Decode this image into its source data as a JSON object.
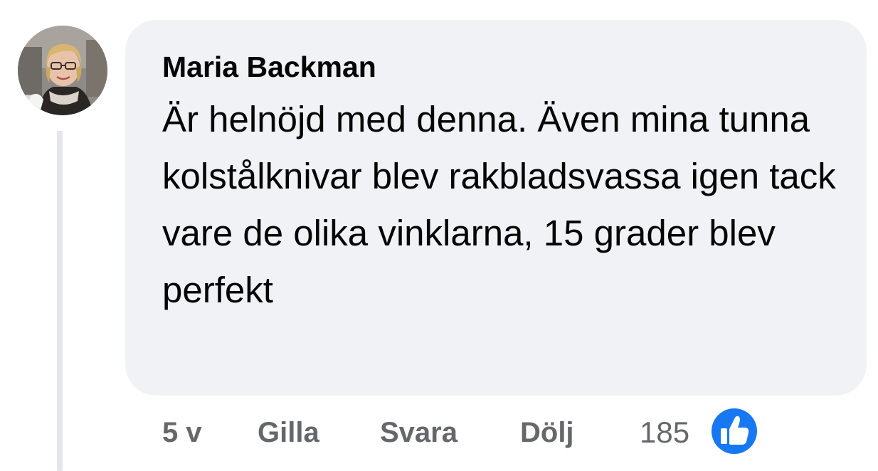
{
  "comment": {
    "author": "Maria Backman",
    "text": "Är helnöjd med denna. Även mina tunna kolstålknivar blev rakbladsvassa igen tack vare de olika vinklarna, 15 grader blev perfekt"
  },
  "actions": {
    "timestamp": "5 v",
    "like_label": "Gilla",
    "reply_label": "Svara",
    "hide_label": "Dölj"
  },
  "reactions": {
    "count": "185",
    "icon": "thumbs-up-icon",
    "badge_color": "#1877f2"
  },
  "colors": {
    "bubble": "#f0f2f5",
    "meta_text": "#65676b",
    "text": "#050505",
    "thread_line": "#e4e6eb"
  }
}
